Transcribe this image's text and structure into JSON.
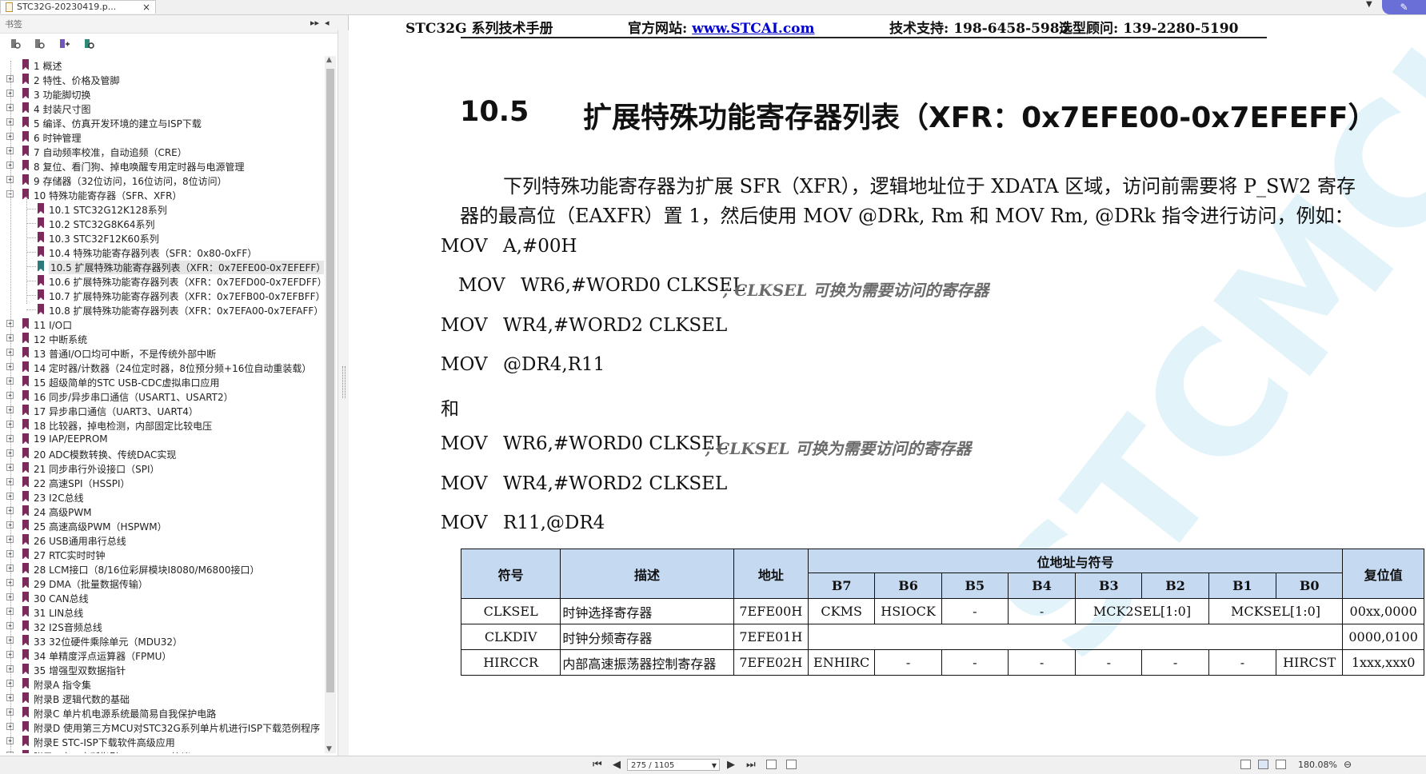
{
  "tab": {
    "title": "STC32G-20230419.p...",
    "close": "×"
  },
  "sidebar": {
    "header": "书签",
    "collapse_glyph": "▸▸",
    "pin_glyph": "◂",
    "tools": [
      "bookmark-expand-icon",
      "bookmark-collapse-icon",
      "bookmark-add-icon",
      "bookmark-find-icon"
    ],
    "items": [
      "1 概述",
      "2 特性、价格及管脚",
      "3 功能脚切换",
      "4 封装尺寸图",
      "5 编译、仿真开发环境的建立与ISP下载",
      "6 时钟管理",
      "7 自动频率校准，自动追频（CRE）",
      "8 复位、看门狗、掉电唤醒专用定时器与电源管理",
      "9 存储器（32位访问，16位访问，8位访问）",
      "10 特殊功能寄存器（SFR、XFR）",
      "10.1 STC32G12K128系列",
      "10.2 STC32G8K64系列",
      "10.3 STC32F12K60系列",
      "10.4 特殊功能寄存器列表（SFR：0x80-0xFF）",
      "10.5 扩展特殊功能寄存器列表（XFR：0x7EFE00-0x7EFEFF）",
      "10.6 扩展特殊功能寄存器列表（XFR：0x7EFD00-0x7EFDFF）",
      "10.7 扩展特殊功能寄存器列表（XFR：0x7EFB00-0x7EFBFF）",
      "10.8 扩展特殊功能寄存器列表（XFR：0x7EFA00-0x7EFAFF）",
      "11 I/O口",
      "12 中断系统",
      "13 普通I/O口均可中断，不是传统外部中断",
      "14 定时器/计数器（24位定时器，8位预分频+16位自动重装载）",
      "15 超级简单的STC USB-CDC虚拟串口应用",
      "16 同步/异步串口通信（USART1、USART2）",
      "17 异步串口通信（UART3、UART4）",
      "18 比较器，掉电检测，内部固定比较电压",
      "19 IAP/EEPROM",
      "20 ADC模数转换、传统DAC实现",
      "21 同步串行外设接口（SPI）",
      "22 高速SPI（HSSPI）",
      "23 I2C总线",
      "24 高级PWM",
      "25 高速高级PWM（HSPWM）",
      "26 USB通用串行总线",
      "27 RTC实时时钟",
      "28 LCM接口（8/16位彩屏模块I8080/M6800接口）",
      "29 DMA（批量数据传输）",
      "30 CAN总线",
      "31 LIN总线",
      "32 I2S音频总线",
      "33 32位硬件乘除单元（MDU32）",
      "34 单精度浮点运算器（FPMU）",
      "35 增强型双数据指针",
      "附录A 指令集",
      "附录B 逻辑代数的基础",
      "附录C 单片机电源系统最简易自我保护电路",
      "附录D 使用第三方MCU对STC32G系列单片机进行ISP下载范例程序",
      "附录E STC-ISP下载软件高级应用",
      "附录F 串口中断指引，MODBUS协议"
    ]
  },
  "page": {
    "header_left": "STC32G 系列技术手册",
    "header_site_label": "官方网站: ",
    "header_site_link": "www.STCAI.com",
    "header_support": "技术支持: 198-6458-5985",
    "header_sales": "选型顾问: 139-2280-5190",
    "section_number": "10.5",
    "section_title": "扩展特殊功能寄存器列表（XFR：0x7EFE00-0x7EFEFF）",
    "paragraph": "下列特殊功能寄存器为扩展 SFR（XFR），逻辑地址位于 XDATA 区域，访问前需要将 P_SW2 寄存器的最高位（EAXFR）置 1，然后使用 MOV @DRk, Rm 和 MOV Rm, @DRk 指令进行访问，例如：",
    "code": [
      {
        "op": "MOV",
        "arg": "A,#00H",
        "comment": ""
      },
      {
        "op": "MOV",
        "arg": "WR6,#WORD0 CLKSEL",
        "comment": "; CLKSEL 可换为需要访问的寄存器"
      },
      {
        "op": "MOV",
        "arg": "WR4,#WORD2 CLKSEL",
        "comment": ""
      },
      {
        "op": "MOV",
        "arg": "@DR4,R11",
        "comment": ""
      },
      {
        "op": "和",
        "arg": "",
        "comment": ""
      },
      {
        "op": "MOV",
        "arg": "WR6,#WORD0 CLKSEL",
        "comment": "; CLKSEL 可换为需要访问的寄存器"
      },
      {
        "op": "MOV",
        "arg": "WR4,#WORD2 CLKSEL",
        "comment": ""
      },
      {
        "op": "MOV",
        "arg": "R11,@DR4",
        "comment": ""
      }
    ],
    "watermark": "STCMCU",
    "table": {
      "headers": {
        "symbol": "符号",
        "desc": "描述",
        "addr": "地址",
        "bits": "位地址与符号",
        "reset": "复位值"
      },
      "bit_headers": [
        "B7",
        "B6",
        "B5",
        "B4",
        "B3",
        "B2",
        "B1",
        "B0"
      ],
      "rows": [
        {
          "symbol": "CLKSEL",
          "desc": "时钟选择寄存器",
          "addr": "7EFE00H",
          "b7": "CKMS",
          "b6": "HSIOCK",
          "b5": "-",
          "b4": "-",
          "b32": "MCK2SEL[1:0]",
          "b10": "MCKSEL[1:0]",
          "reset": "00xx,0000"
        },
        {
          "symbol": "CLKDIV",
          "desc": "时钟分频寄存器",
          "addr": "7EFE01H",
          "reset": "0000,0100"
        },
        {
          "symbol": "HIRCCR",
          "desc": "内部高速振荡器控制寄存器",
          "addr": "7EFE02H",
          "b7": "ENHIRC",
          "b6": "-",
          "b5": "-",
          "b4": "-",
          "b3": "-",
          "b2": "-",
          "b1": "-",
          "b0": "HIRCST",
          "reset": "1xxx,xxx0"
        }
      ]
    }
  },
  "statusbar": {
    "page_indicator": "275 / 1105",
    "zoom": "180.08%",
    "zoom_out": "⊖"
  },
  "colors": {
    "table_header_bg": "#c5d9f1",
    "bookmark": "#7b2a5b",
    "link": "#0000cc",
    "accent": "#6a6fd8"
  }
}
